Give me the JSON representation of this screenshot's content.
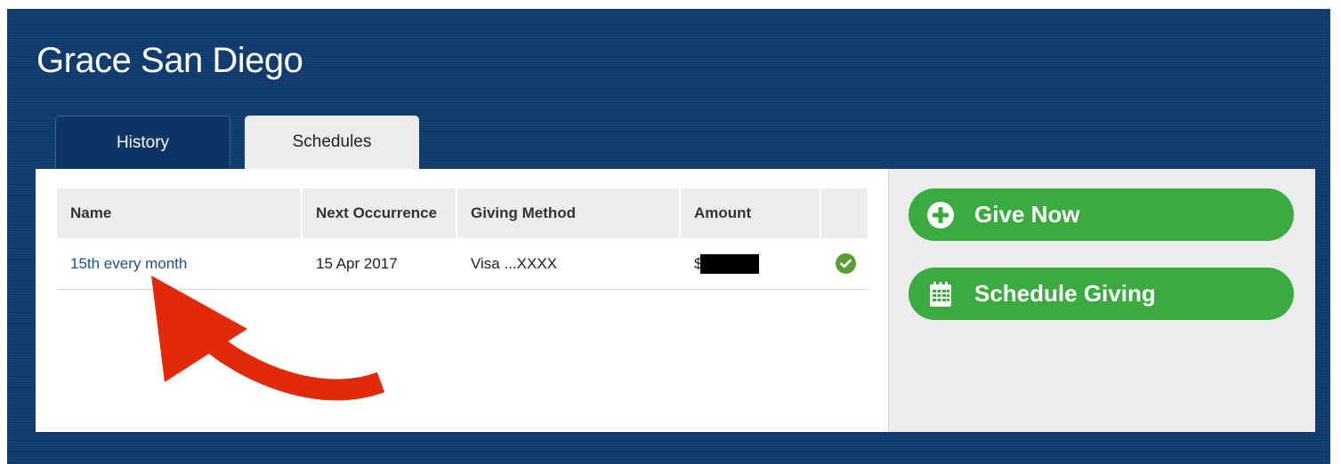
{
  "header": {
    "title": "Grace San Diego"
  },
  "tabs": [
    {
      "label": "History",
      "active": false
    },
    {
      "label": "Schedules",
      "active": true
    }
  ],
  "table": {
    "columns": [
      "Name",
      "Next Occurrence",
      "Giving Method",
      "Amount",
      ""
    ],
    "rows": [
      {
        "name": "15th every month",
        "next_occurrence": "15 Apr 2017",
        "giving_method": "Visa ...XXXX",
        "amount_prefix": "$",
        "status": "active"
      }
    ]
  },
  "sidebar": {
    "give_now_label": "Give Now",
    "give_now_icon": "plus-circle-icon",
    "schedule_label": "Schedule Giving",
    "schedule_icon": "calendar-icon"
  },
  "colors": {
    "background": "#0f3b6e",
    "accent_green": "#3aab3f",
    "link": "#1f4f86",
    "annotation_arrow": "#e12a0a"
  }
}
